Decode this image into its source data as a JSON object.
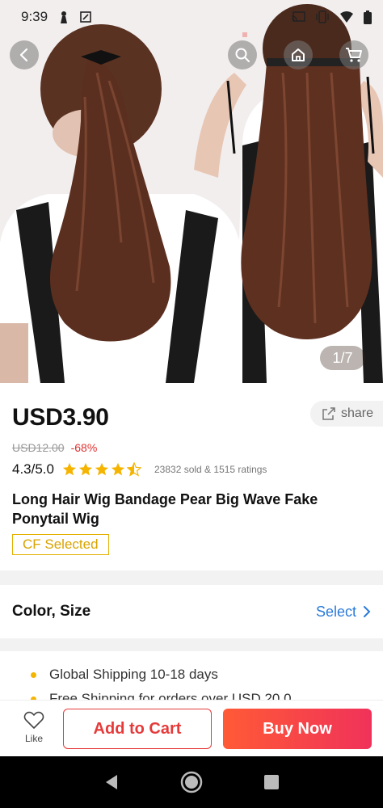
{
  "status_bar": {
    "time": "9:39",
    "icons_left": [
      "notification-icon",
      "screenshot-icon"
    ],
    "icons_right": [
      "cast-icon",
      "vibrate-icon",
      "wifi-icon",
      "battery-icon"
    ]
  },
  "gallery": {
    "counter": "1/7",
    "controls": [
      "back-icon",
      "search-icon",
      "home-icon",
      "cart-icon"
    ]
  },
  "product": {
    "price": "USD3.90",
    "share_label": "share",
    "original_price": "USD12.00",
    "discount": "-68%",
    "rating": "4.3/5.0",
    "star_rating": 4.3,
    "sold_info": "23832 sold & 1515 ratings",
    "title": "Long Hair Wig Bandage Pear Big Wave Fake Ponytail Wig",
    "badge": "CF Selected"
  },
  "options": {
    "label": "Color, Size",
    "select_label": "Select"
  },
  "shipping": {
    "items": [
      "Global Shipping 10-18 days",
      "Free Shipping for orders over USD 20.0"
    ]
  },
  "actions": {
    "like_label": "Like",
    "add_to_cart": "Add to Cart",
    "buy_now": "Buy Now"
  },
  "colors": {
    "accent_red": "#e63a3a",
    "link_blue": "#2a7bd8",
    "badge_gold": "#d9a300",
    "star_gold": "#f5b400"
  }
}
